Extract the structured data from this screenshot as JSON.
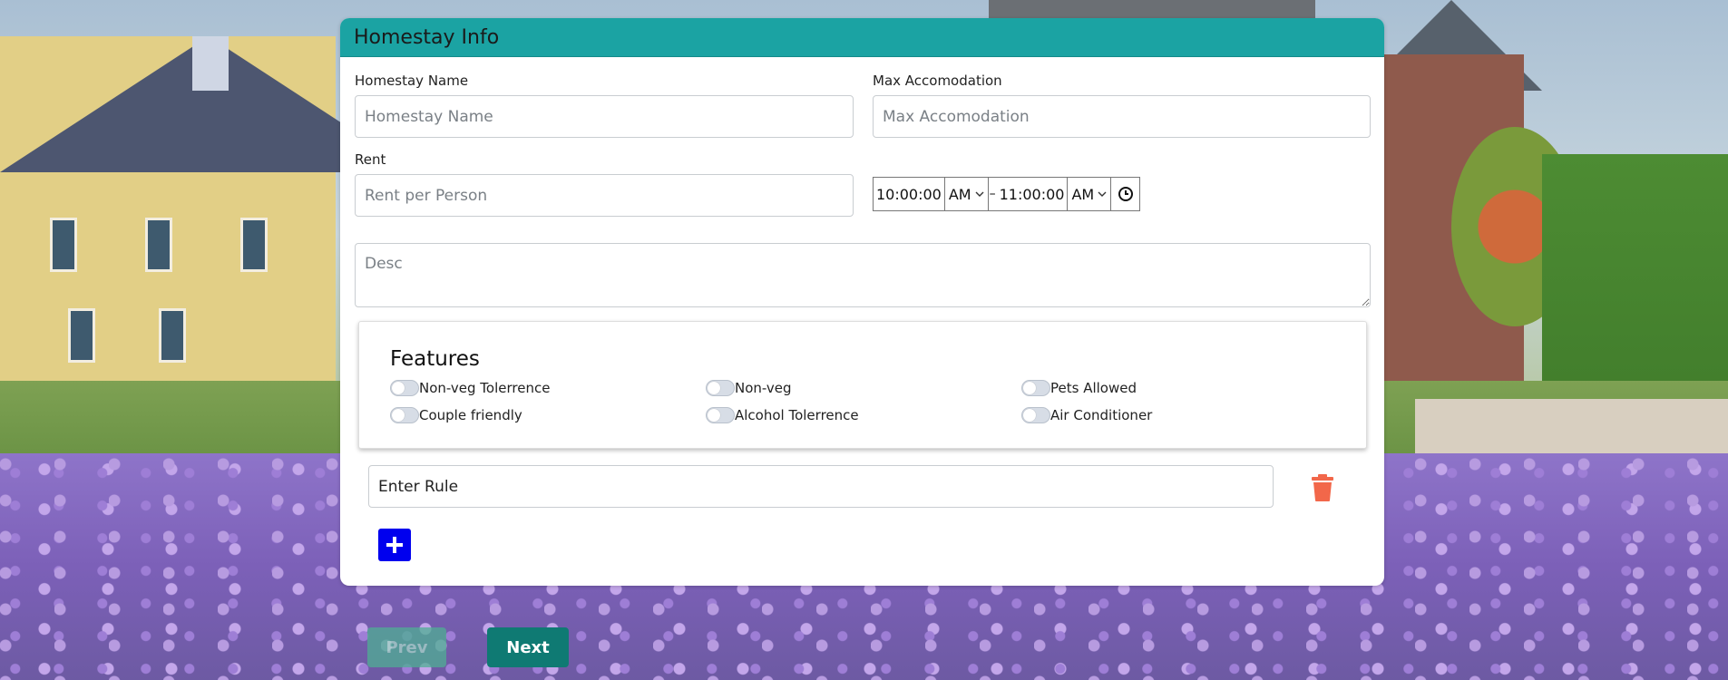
{
  "card": {
    "title": "Homestay Info"
  },
  "fields": {
    "homestay_name": {
      "label": "Homestay Name",
      "placeholder": "Homestay Name"
    },
    "max_accommodation": {
      "label": "Max Accomodation",
      "placeholder": "Max Accomodation"
    },
    "rent": {
      "label": "Rent",
      "placeholder": "Rent per Person"
    },
    "desc": {
      "placeholder": "Desc"
    }
  },
  "time_range": {
    "start_time": "10:00:00",
    "start_ampm": "AM",
    "separator": "–",
    "end_time": "11:00:00",
    "end_ampm": "AM",
    "clock_icon": "clock-icon"
  },
  "features": {
    "title": "Features",
    "items": [
      {
        "label": "Non-veg Tolerrence",
        "enabled": false
      },
      {
        "label": "Non-veg",
        "enabled": false
      },
      {
        "label": "Pets Allowed",
        "enabled": false
      },
      {
        "label": "Couple friendly",
        "enabled": false
      },
      {
        "label": "Alcohol Tolerrence",
        "enabled": false
      },
      {
        "label": "Air Conditioner",
        "enabled": false
      }
    ]
  },
  "rules": {
    "value": "Enter Rule",
    "delete_icon": "trash-icon",
    "add_icon": "plus-icon",
    "delete_color": "#f2674a",
    "add_color": "#0000ee"
  },
  "nav": {
    "prev_label": "Prev",
    "next_label": "Next"
  },
  "colors": {
    "header": "#1ba3a3",
    "next": "#0f7a73",
    "prev": "#4fae94"
  }
}
